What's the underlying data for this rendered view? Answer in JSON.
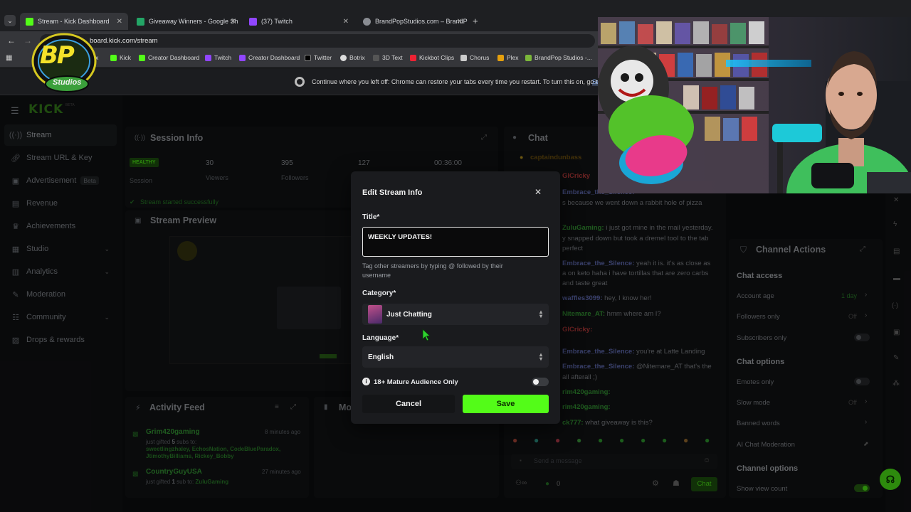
{
  "browser": {
    "tabs": [
      {
        "label": "Stream - Kick Dashboard",
        "color": "#53fc18"
      },
      {
        "label": "Giveaway Winners - Google Sh",
        "color": "#23a566"
      },
      {
        "label": "(37) Twitch",
        "color": "#9146ff"
      },
      {
        "label": "BrandPopStudios.com – BrandP",
        "color": "#8a8d93"
      }
    ],
    "url": "board.kick.com/stream",
    "bookmarks": [
      "ubox",
      "Kick",
      "Creator Dashboard",
      "Twitch",
      "Creator Dashboard",
      "Twitter",
      "Botrix",
      "3D Text",
      "Kickbot Clips",
      "Chorus",
      "Plex",
      "BrandPop Studios -..."
    ],
    "bookmark_prefix": "PS",
    "restore_msg": "Continue where you left off: Chrome can restore your tabs every time you restart. To turn this on, go to",
    "restore_link": "Se"
  },
  "logo_overlay": {
    "text1": "BP",
    "text2": "Studios"
  },
  "kick": {
    "logo": "KICK",
    "logo_badge": "BETA",
    "nav": [
      {
        "label": "Stream",
        "icon": "signal-icon"
      },
      {
        "label": "Stream URL & Key",
        "icon": "link-icon"
      },
      {
        "label": "Advertisement",
        "icon": "ad-icon",
        "badge": "Beta"
      },
      {
        "label": "Revenue",
        "icon": "revenue-icon"
      },
      {
        "label": "Achievements",
        "icon": "trophy-icon"
      },
      {
        "label": "Studio",
        "icon": "studio-icon",
        "chevron": true
      },
      {
        "label": "Analytics",
        "icon": "analytics-icon",
        "chevron": true
      },
      {
        "label": "Moderation",
        "icon": "wrench-icon"
      },
      {
        "label": "Community",
        "icon": "community-icon",
        "chevron": true
      },
      {
        "label": "Drops & rewards",
        "icon": "gift-icon"
      }
    ],
    "session": {
      "title": "Session Info",
      "status": "HEALTHY",
      "status_sub": "Session",
      "viewers": "30",
      "viewers_label": "Viewers",
      "followers": "395",
      "followers_label": "Followers",
      "third": "127",
      "time": "00:36:00",
      "started": "Stream started successfully"
    },
    "preview_title": "Stream Preview",
    "activity": {
      "title": "Activity Feed",
      "items": [
        {
          "user": "Grim420gaming",
          "time": "8 minutes ago",
          "pre": "just gifted",
          "count": "5",
          "post": "subs to:",
          "names": "sweetlingzhaley, EchosNation, CodeBlueParadox, JtimothyBilliams, Rickey_Bobby"
        },
        {
          "user": "CountryGuyUSA",
          "time": "27 minutes ago",
          "pre": "just gifted",
          "count": "1",
          "post": "sub to:",
          "names": "ZuluGaming"
        }
      ]
    },
    "mod_panel_title": "Mo",
    "chat": {
      "title": "Chat",
      "pinned": "captaindunbass",
      "messages": [
        {
          "user": "GlCricky",
          "text": ""
        },
        {
          "user": "Embrace_the_Silence:",
          "text": ""
        },
        {
          "user": "",
          "text": "s because we went down a rabbit hole of pizza"
        },
        {
          "user": "ZuluGaming:",
          "text": "i just got mine in the mail yesterday."
        },
        {
          "user": "",
          "text": "y snapped down but took a dremel tool to the tab"
        },
        {
          "user": "",
          "text": "perfect"
        },
        {
          "user": "Embrace_the_Silence:",
          "text": "yeah it is. it's as close as"
        },
        {
          "user": "",
          "text": "a on keto haha i have tortillas that are zero carbs"
        },
        {
          "user": "",
          "text": "and taste great"
        },
        {
          "user": "waffles3099:",
          "text": "hey, I know her!"
        },
        {
          "user": "Nitemare_AT:",
          "text": "hmm where am I?"
        },
        {
          "user": "GlCricky:",
          "text": ""
        },
        {
          "user": "Embrace_the_Silence:",
          "text": "you're at Latte Landing"
        },
        {
          "user": "Embrace_the_Silence:",
          "text": "@Nitemare_AT that's the"
        },
        {
          "user": "",
          "text": "all afterall ;)"
        },
        {
          "user": "rim420gaming:",
          "text": ""
        },
        {
          "user": "rim420gaming:",
          "text": ""
        },
        {
          "user": "ck777:",
          "text": "what giveaway is this?"
        }
      ],
      "placeholder": "Send a message",
      "count": "0",
      "send": "Chat"
    },
    "channel_actions": {
      "title": "Channel Actions",
      "chat_access": "Chat access",
      "account_age": "Account age",
      "account_age_val": "1 day",
      "followers_only": "Followers only",
      "followers_only_val": "Off",
      "subscribers_only": "Subscribers only",
      "chat_options": "Chat options",
      "emotes_only": "Emotes only",
      "slow_mode": "Slow mode",
      "slow_mode_val": "Off",
      "banned_words": "Banned words",
      "ai_mod": "AI Chat Moderation",
      "channel_options": "Channel options",
      "show_view_count": "Show view count"
    }
  },
  "modal": {
    "title": "Edit Stream Info",
    "title_label": "Title*",
    "title_value": "WEEKLY UPDATES!",
    "tag_help": "Tag other streamers by typing @ followed by their username",
    "category_label": "Category*",
    "category_value": "Just Chatting",
    "language_label": "Language*",
    "language_value": "English",
    "mature_label": "18+ Mature Audience Only",
    "cancel": "Cancel",
    "save": "Save"
  },
  "colors": {
    "kick_green": "#53fc18",
    "modal_bg": "#1a1b1e"
  }
}
